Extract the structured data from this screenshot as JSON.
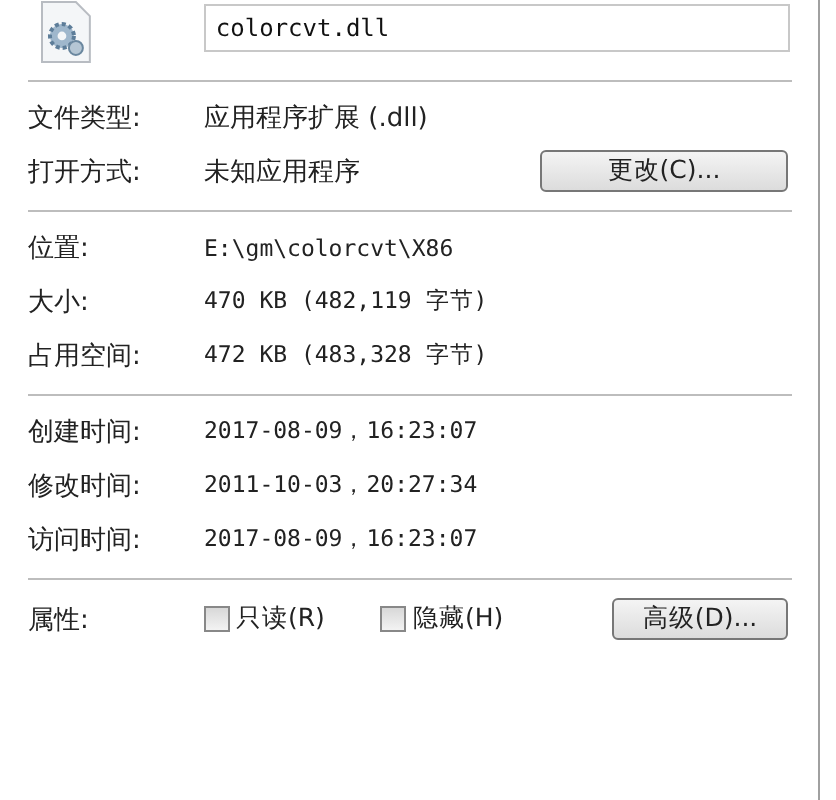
{
  "file_name": "colorcvt.dll",
  "general": [
    {
      "label": "文件类型:",
      "value": "应用程序扩展 (.dll)"
    },
    {
      "label": "打开方式:",
      "value": "未知应用程序",
      "button": "更改(C)..."
    }
  ],
  "location": [
    {
      "label": "位置:",
      "value": "E:\\gm\\colorcvt\\X86"
    },
    {
      "label": "大小:",
      "value": "470 KB (482,119 字节)"
    },
    {
      "label": "占用空间:",
      "value": "472 KB (483,328 字节)"
    }
  ],
  "times": [
    {
      "label": "创建时间:",
      "value": "2017-08-09，16:23:07"
    },
    {
      "label": "修改时间:",
      "value": "2011-10-03，20:27:34"
    },
    {
      "label": "访问时间:",
      "value": "2017-08-09，16:23:07"
    }
  ],
  "attributes": {
    "label": "属性:",
    "checkboxes": [
      {
        "label": "只读(R)",
        "checked": false
      },
      {
        "label": "隐藏(H)",
        "checked": false
      }
    ],
    "button": "高级(D)..."
  }
}
